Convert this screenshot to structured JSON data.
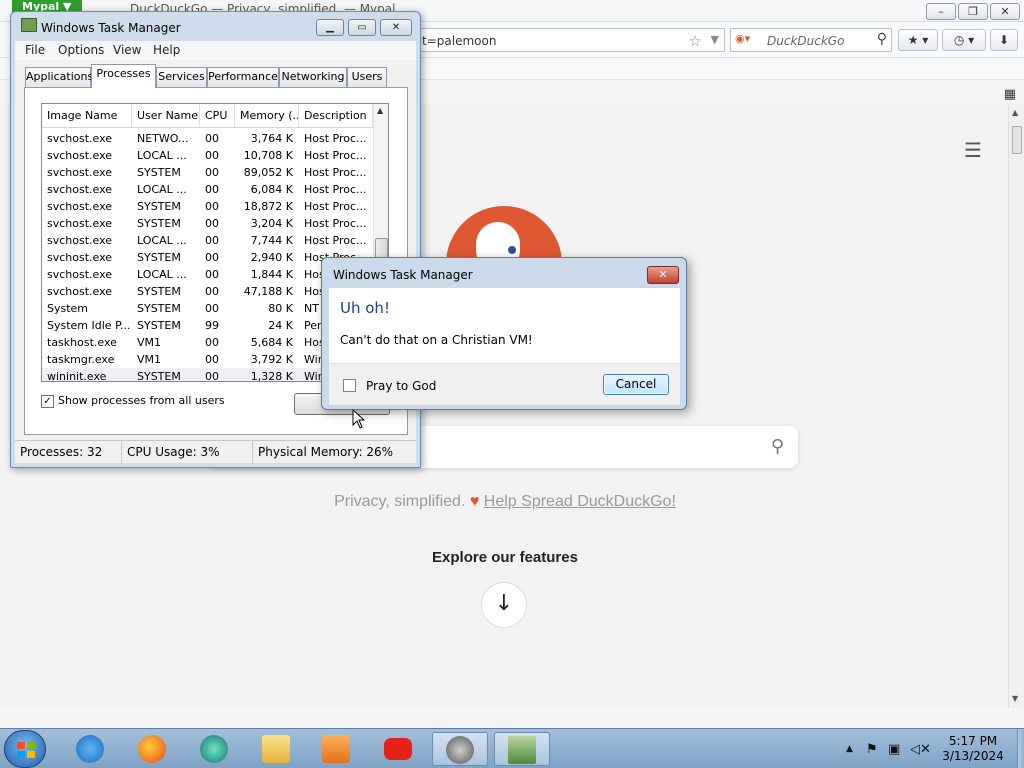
{
  "browser": {
    "app_button": "Mypal ▼",
    "title": "DuckDuckGo — Privacy, simplified. — Mypal",
    "window_buttons": {
      "min": "–",
      "max": "❐",
      "close": "✕"
    },
    "url": "t=palemoon",
    "search_engine_placeholder": "DuckDuckGo",
    "scroll_up": "▲",
    "scroll_down": "▼"
  },
  "ddg": {
    "tagline": "Privacy, simplified.",
    "help_link": "Help Spread DuckDuckGo!",
    "explore": "Explore our features",
    "arrow": "↓"
  },
  "taskmgr": {
    "title": "Windows Task Manager",
    "window_buttons": {
      "min": "▁",
      "max": "▭",
      "close": "✕"
    },
    "menu": [
      "File",
      "Options",
      "View",
      "Help"
    ],
    "tabs": [
      "Applications",
      "Processes",
      "Services",
      "Performance",
      "Networking",
      "Users"
    ],
    "active_tab": "Processes",
    "columns": [
      "Image Name",
      "User Name",
      "CPU",
      "Memory (...",
      "Description"
    ],
    "rows": [
      {
        "name": "svchost.exe",
        "user": "NETWO...",
        "cpu": "00",
        "mem": "3,764 K",
        "desc": "Host Proc..."
      },
      {
        "name": "svchost.exe",
        "user": "LOCAL ...",
        "cpu": "00",
        "mem": "10,708 K",
        "desc": "Host Proc..."
      },
      {
        "name": "svchost.exe",
        "user": "SYSTEM",
        "cpu": "00",
        "mem": "89,052 K",
        "desc": "Host Proc..."
      },
      {
        "name": "svchost.exe",
        "user": "LOCAL ...",
        "cpu": "00",
        "mem": "6,084 K",
        "desc": "Host Proc..."
      },
      {
        "name": "svchost.exe",
        "user": "SYSTEM",
        "cpu": "00",
        "mem": "18,872 K",
        "desc": "Host Proc..."
      },
      {
        "name": "svchost.exe",
        "user": "SYSTEM",
        "cpu": "00",
        "mem": "3,204 K",
        "desc": "Host Proc..."
      },
      {
        "name": "svchost.exe",
        "user": "LOCAL ...",
        "cpu": "00",
        "mem": "7,744 K",
        "desc": "Host Proc..."
      },
      {
        "name": "svchost.exe",
        "user": "SYSTEM",
        "cpu": "00",
        "mem": "2,940 K",
        "desc": "Host Proc..."
      },
      {
        "name": "svchost.exe",
        "user": "LOCAL ...",
        "cpu": "00",
        "mem": "1,844 K",
        "desc": "Hos"
      },
      {
        "name": "svchost.exe",
        "user": "SYSTEM",
        "cpu": "00",
        "mem": "47,188 K",
        "desc": "Hos"
      },
      {
        "name": "System",
        "user": "SYSTEM",
        "cpu": "00",
        "mem": "80 K",
        "desc": "NT"
      },
      {
        "name": "System Idle P...",
        "user": "SYSTEM",
        "cpu": "99",
        "mem": "24 K",
        "desc": "Per"
      },
      {
        "name": "taskhost.exe",
        "user": "VM1",
        "cpu": "00",
        "mem": "5,684 K",
        "desc": "Hos"
      },
      {
        "name": "taskmgr.exe",
        "user": "VM1",
        "cpu": "00",
        "mem": "3,792 K",
        "desc": "Win"
      },
      {
        "name": "wininit.exe",
        "user": "SYSTEM",
        "cpu": "00",
        "mem": "1,328 K",
        "desc": "Win"
      }
    ],
    "selected_row": 14,
    "show_all_label": "Show processes from all users",
    "show_all_checked": true,
    "end_button": "E",
    "status": {
      "processes": "Processes: 32",
      "cpu": "CPU Usage: 3%",
      "memory": "Physical Memory: 26%"
    }
  },
  "dialog": {
    "title": "Windows Task Manager",
    "close": "✕",
    "heading": "Uh oh!",
    "message": "Can't do that on a Christian VM!",
    "checkbox_label": "Pray to God",
    "cancel": "Cancel"
  },
  "taskbar": {
    "apps": [
      "Internet Explorer",
      "Firefox",
      "Browser",
      "Windows Explorer",
      "Media Player",
      "YouTube",
      "Mypal",
      "Task Manager"
    ],
    "time": "5:17 PM",
    "date": "3/13/2024"
  },
  "colors": {
    "ddg_orange": "#de5833",
    "dialog_heading": "#1e3e8c"
  }
}
